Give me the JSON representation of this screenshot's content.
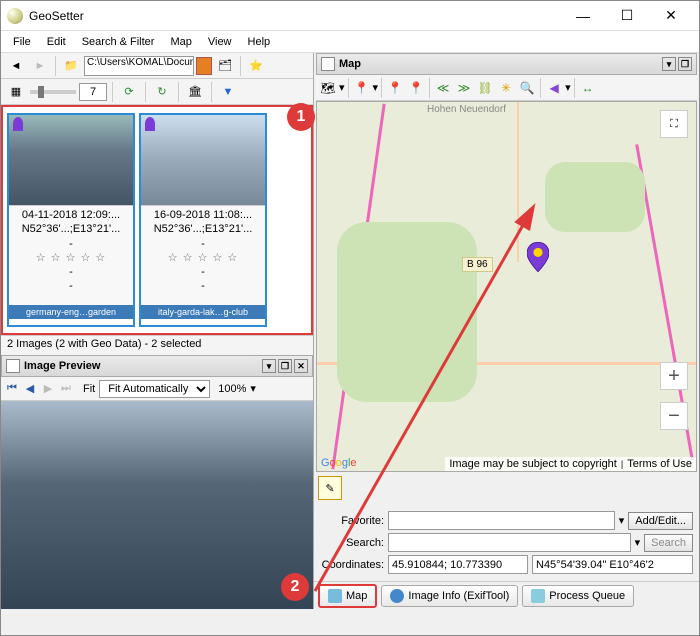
{
  "window": {
    "title": "GeoSetter"
  },
  "menu": {
    "file": "File",
    "edit": "Edit",
    "search": "Search & Filter",
    "map": "Map",
    "view": "View",
    "help": "Help"
  },
  "toolbar": {
    "path": "C:\\Users\\KOMAL\\Docum",
    "thumb_cols": "7"
  },
  "thumbs": {
    "t1": {
      "date": "04-11-2018 12:09:...",
      "coords": "N52°36'...;E13°21'...",
      "dash1": "-",
      "stars": "☆ ☆ ☆ ☆ ☆",
      "dash2": "-",
      "dash3": "-",
      "label": "germany-eng…garden"
    },
    "t2": {
      "date": "16-09-2018 11:08:...",
      "coords": "N52°36'...;E13°21'...",
      "dash1": "-",
      "stars": "☆ ☆ ☆ ☆ ☆",
      "dash2": "-",
      "dash3": "-",
      "label": "italy-garda-lak…g-club"
    }
  },
  "status": "2 Images (2 with Geo Data) - 2 selected",
  "preview": {
    "title": "Image Preview",
    "fit_label": "Fit",
    "fit_mode": "Fit Automatically",
    "zoom": "100%"
  },
  "mappane": {
    "title": "Map",
    "b96": "B 96",
    "top_label": "Hohen Neuendorf",
    "attrib1": "Image may be subject to copyright",
    "attrib2": "Terms of Use"
  },
  "form": {
    "fav_label": "Favorite:",
    "add_edit": "Add/Edit...",
    "search_label": "Search:",
    "search_btn": "Search",
    "coord_label": "Coordinates:",
    "coords_dec": "45.910844; 10.773390",
    "coords_dms": "N45°54'39.04\" E10°46'2"
  },
  "tabs": {
    "map": "Map",
    "info": "Image Info (ExifTool)",
    "queue": "Process Queue"
  },
  "callouts": {
    "one": "1",
    "two": "2"
  }
}
